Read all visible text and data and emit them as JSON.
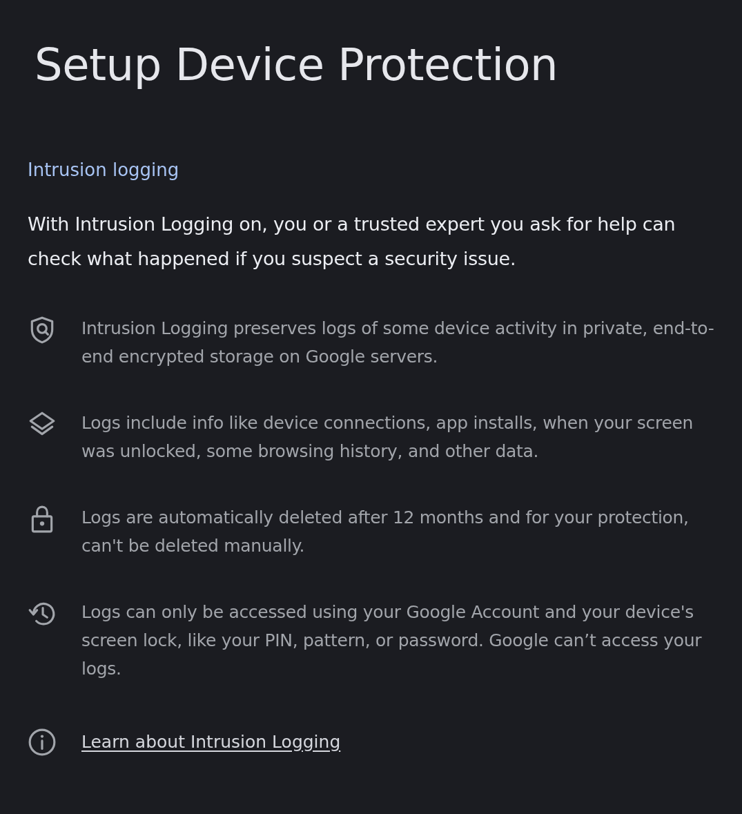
{
  "title": "Setup Device Protection",
  "section_header": "Intrusion logging",
  "intro": "With Intrusion Logging on, you or a trusted expert you ask for help can check what happened if you suspect a security issue.",
  "items": [
    {
      "kind": "shield",
      "text": "Intrusion Logging preserves logs of some device activity in private, end-to-end encrypted storage on Google servers."
    },
    {
      "kind": "layers",
      "text": "Logs include info like device connections, app installs, when your screen was unlocked, some browsing history, and other data."
    },
    {
      "kind": "lock",
      "text": "Logs are automatically deleted after 12 months and for your protection, can't be deleted manually."
    },
    {
      "kind": "history",
      "text": "Logs can only be accessed using your Google Account and your device's screen lock, like your PIN, pattern, or password. Google can’t access your logs."
    }
  ],
  "link": {
    "text": "Learn about Intrusion Logging"
  }
}
